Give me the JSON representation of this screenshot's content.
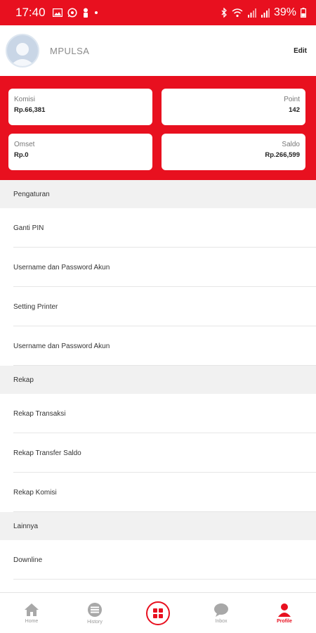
{
  "statusbar": {
    "time": "17:40",
    "battery": "39%",
    "left_icons": [
      "image-icon",
      "whatsapp-icon",
      "person-icon",
      "dot-icon"
    ],
    "right_icons": [
      "bluetooth-icon",
      "wifi-icon",
      "signal-icon",
      "signal-icon",
      "battery-icon"
    ]
  },
  "profile": {
    "name": "MPULSA",
    "edit_label": "Edit"
  },
  "stats": {
    "komisi": {
      "label": "Komisi",
      "value": "Rp.66,381"
    },
    "point": {
      "label": "Point",
      "value": "142"
    },
    "omset": {
      "label": "Omset",
      "value": "Rp.0"
    },
    "saldo": {
      "label": "Saldo",
      "value": "Rp.266,599"
    }
  },
  "sections": {
    "pengaturan": {
      "title": "Pengaturan",
      "items": [
        "Ganti PIN",
        "Username dan Password Akun",
        "Setting Printer",
        "Username dan Password Akun"
      ]
    },
    "rekap": {
      "title": "Rekap",
      "items": [
        "Rekap Transaksi",
        "Rekap Transfer Saldo",
        "Rekap Komisi"
      ]
    },
    "lainnya": {
      "title": "Lainnya",
      "items": [
        "Downline"
      ]
    }
  },
  "bottom_nav": {
    "home": "Home",
    "history": "History",
    "inbox": "Inbox",
    "profile": "Profile"
  },
  "colors": {
    "accent": "#e8101f",
    "section_bg": "#f1f1f1"
  }
}
